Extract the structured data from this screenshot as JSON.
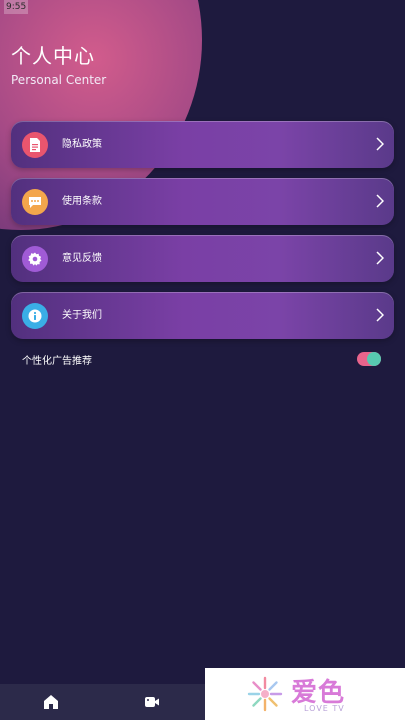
{
  "status_bar": {
    "time": "9:55"
  },
  "header": {
    "title": "个人中心",
    "subtitle": "Personal Center"
  },
  "menu": {
    "items": [
      {
        "label": "隐私政策",
        "icon": "document-icon",
        "icon_color": "#e9556e"
      },
      {
        "label": "使用条款",
        "icon": "chat-bubble-icon",
        "icon_color": "#f3a64c"
      },
      {
        "label": "意见反馈",
        "icon": "gear-icon",
        "icon_color": "#a05bd6"
      },
      {
        "label": "关于我们",
        "icon": "info-icon",
        "icon_color": "#3aaee6"
      }
    ]
  },
  "settings": {
    "personalized_ads_label": "个性化广告推荐",
    "personalized_ads_enabled": true
  },
  "bottom_nav": {
    "items": [
      {
        "icon": "home-icon"
      },
      {
        "icon": "video-camera-icon"
      }
    ]
  },
  "watermark": {
    "title": "爱色",
    "subtitle": "LOVE TV"
  },
  "colors": {
    "background": "#1e1a3e",
    "accent_pink": "#d25c8c",
    "toggle_track": "#e8648c",
    "toggle_knob": "#57c9b0"
  }
}
